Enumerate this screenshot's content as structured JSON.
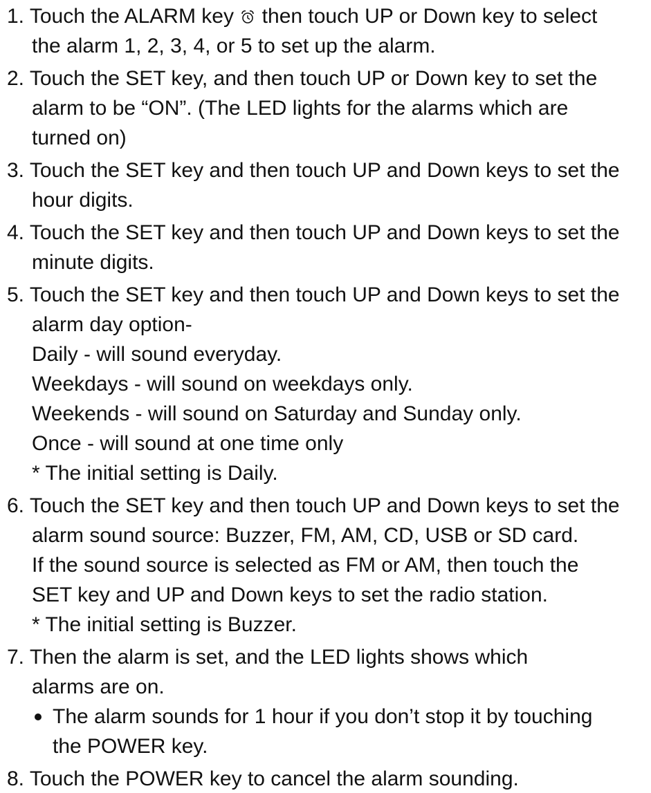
{
  "steps": [
    {
      "number": "1.",
      "lines": [
        "Touch the ALARM key",
        "then touch UP or Down key to select",
        "the alarm 1, 2, 3, 4, or 5 to set up the alarm."
      ],
      "icon": "alarm-clock-icon"
    },
    {
      "number": "2.",
      "lines": [
        "Touch the SET key, and then touch UP or Down key to set the",
        "alarm to be “ON”. (The LED lights for the alarms which are",
        "turned on)"
      ]
    },
    {
      "number": "3.",
      "lines": [
        "Touch the SET key and then touch UP and Down keys to set the",
        "hour digits."
      ]
    },
    {
      "number": "4.",
      "lines": [
        "Touch the SET key and then touch UP and Down keys to set the",
        "minute digits."
      ]
    },
    {
      "number": "5.",
      "lines": [
        "Touch the SET key and then touch UP and Down keys to set the",
        "alarm day option-",
        "Daily - will sound everyday.",
        "Weekdays - will sound on weekdays only.",
        "Weekends - will sound on Saturday and Sunday only.",
        "Once - will sound at one time only",
        "* The initial setting is Daily."
      ]
    },
    {
      "number": "6.",
      "lines": [
        "Touch the SET key and then touch UP and Down keys to set the",
        "alarm sound source: Buzzer, FM, AM, CD, USB or SD card.",
        "If the sound source is selected as FM or AM, then touch the",
        "SET key and UP and Down keys to set the radio station.",
        "* The initial setting is Buzzer."
      ]
    },
    {
      "number": "7.",
      "lines": [
        "Then the alarm is set, and the LED lights shows which",
        "alarms are on."
      ],
      "bullet": [
        "The alarm sounds for 1 hour if you don’t stop it by touching",
        "the POWER key."
      ]
    },
    {
      "number": "8.",
      "lines": [
        "Touch the POWER key to cancel the alarm sounding."
      ]
    }
  ]
}
